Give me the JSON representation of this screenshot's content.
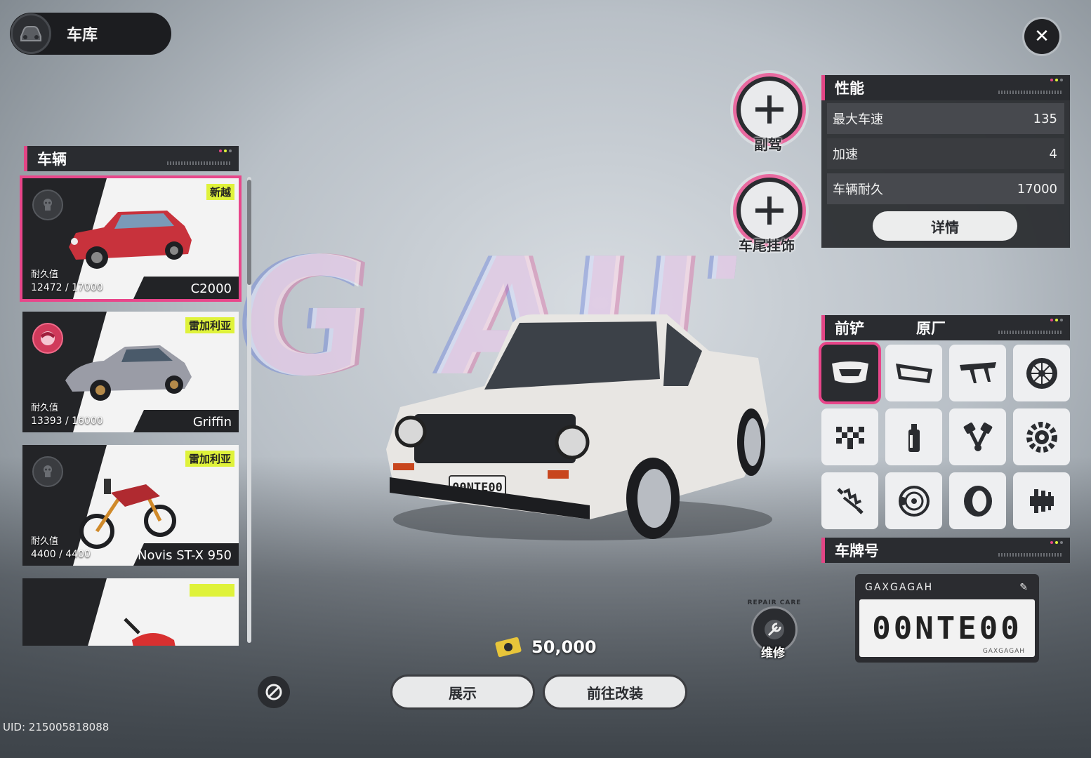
{
  "header": {
    "title": "车库",
    "logo_icon": "garage-car-icon"
  },
  "close_icon": "close-icon",
  "background_text": "G AUTO",
  "vehicles_section": {
    "title": "车辆"
  },
  "vehicles": [
    {
      "tag": "新越",
      "durability_label": "耐久值",
      "durability": "12472 / 17000",
      "name": "C2000",
      "selected": true,
      "color": "#c8323c"
    },
    {
      "tag": "雷加利亚",
      "durability_label": "耐久值",
      "durability": "13393 / 16000",
      "name": "Griffin",
      "selected": false,
      "color": "#9a9ca6"
    },
    {
      "tag": "雷加利亚",
      "durability_label": "耐久值",
      "durability": "4400 / 4400",
      "name": "Novis ST-X 950",
      "selected": false,
      "color": "#b02a30"
    },
    {
      "tag": "",
      "durability_label": "",
      "durability": "",
      "name": "",
      "selected": false,
      "color": "#d83030"
    }
  ],
  "slots": {
    "copilot_label": "副驾",
    "trunk_label": "车尾挂饰"
  },
  "performance": {
    "title": "性能",
    "rows": [
      {
        "label": "最大车速",
        "value": "135"
      },
      {
        "label": "加速",
        "value": "4"
      },
      {
        "label": "车辆耐久",
        "value": "17000"
      }
    ],
    "details_label": "详情"
  },
  "parts_section": {
    "title": "前铲",
    "subtitle": "原厂"
  },
  "parts": [
    {
      "icon": "front-bumper-icon",
      "selected": true
    },
    {
      "icon": "rear-bumper-icon",
      "selected": false
    },
    {
      "icon": "spoiler-icon",
      "selected": false
    },
    {
      "icon": "wheel-rim-icon",
      "selected": false
    },
    {
      "icon": "livery-checker-icon",
      "selected": false
    },
    {
      "icon": "spray-paint-icon",
      "selected": false
    },
    {
      "icon": "engine-piston-icon",
      "selected": false
    },
    {
      "icon": "transmission-gear-icon",
      "selected": false
    },
    {
      "icon": "suspension-spring-icon",
      "selected": false
    },
    {
      "icon": "brake-disc-icon",
      "selected": false
    },
    {
      "icon": "tire-icon",
      "selected": false
    },
    {
      "icon": "clutch-icon",
      "selected": false
    }
  ],
  "plate_section": {
    "title": "车牌号"
  },
  "plate": {
    "number": "00NTE00",
    "brand": "GAXGAGAH",
    "small": "GAXGAGAH"
  },
  "repair": {
    "label": "维修",
    "ring": "REPAIR CARE"
  },
  "money": {
    "amount": "50,000",
    "icon": "currency-card-icon"
  },
  "buttons": {
    "show": "展示",
    "modify": "前往改装"
  },
  "car_plate_front": "00NTE00",
  "uid": "UID: 215005818088"
}
